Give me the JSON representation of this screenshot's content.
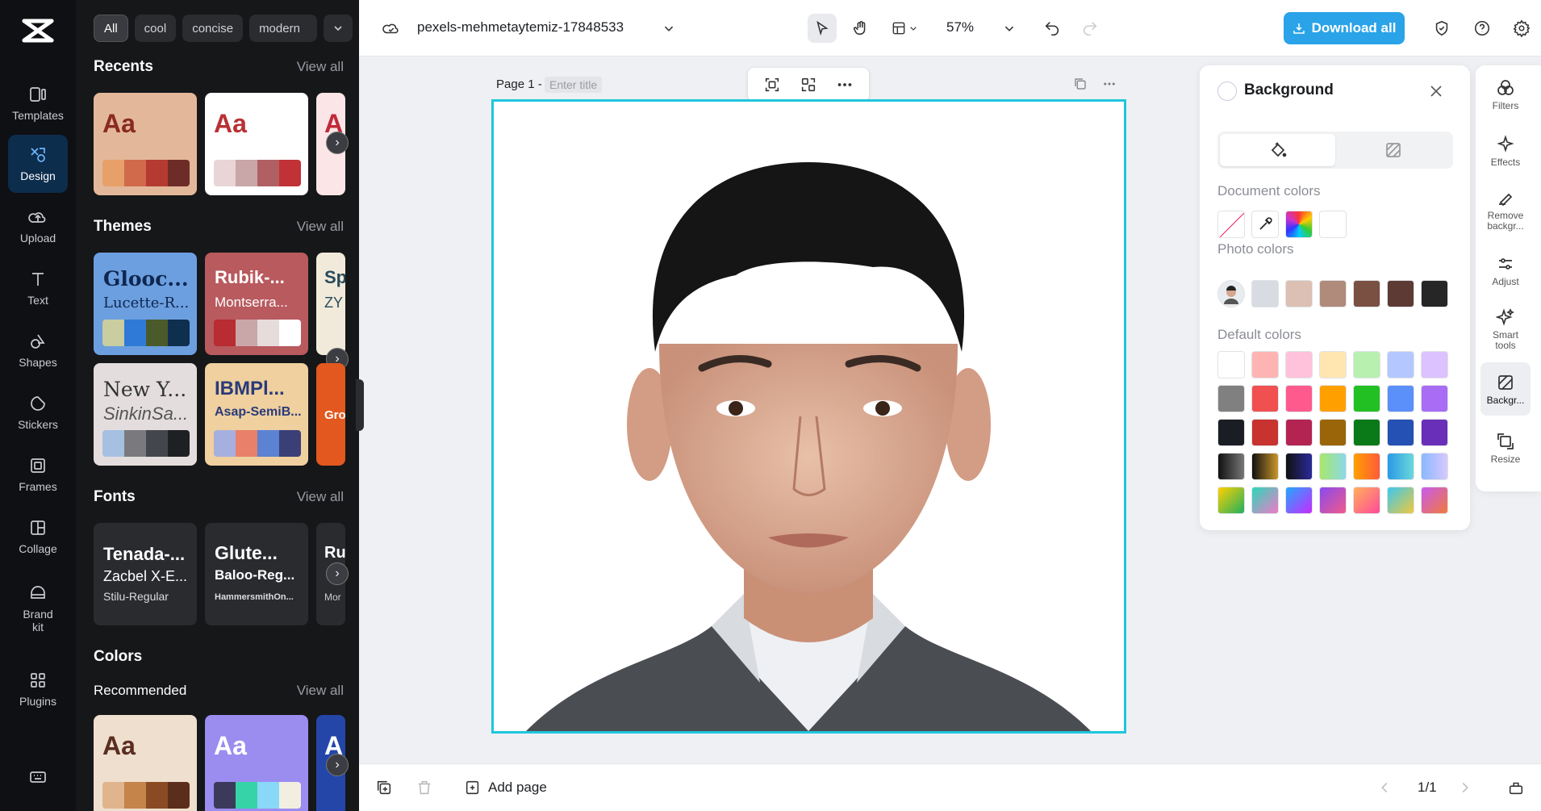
{
  "nav": {
    "items": [
      {
        "label": "Templates",
        "icon": "templates-icon"
      },
      {
        "label": "Design",
        "icon": "design-icon"
      },
      {
        "label": "Upload",
        "icon": "upload-icon"
      },
      {
        "label": "Text",
        "icon": "text-icon"
      },
      {
        "label": "Shapes",
        "icon": "shapes-icon"
      },
      {
        "label": "Stickers",
        "icon": "stickers-icon"
      },
      {
        "label": "Frames",
        "icon": "frames-icon"
      },
      {
        "label": "Collage",
        "icon": "collage-icon"
      },
      {
        "label": "Brand kit",
        "icon": "brand-kit-icon"
      },
      {
        "label": "Plugins",
        "icon": "plugins-icon"
      }
    ]
  },
  "panel": {
    "chips": [
      "All",
      "cool",
      "concise",
      "modern"
    ],
    "recents": {
      "title": "Recents",
      "view_all": "View all"
    },
    "themes": {
      "title": "Themes",
      "view_all": "View all",
      "row1": [
        {
          "t1": "Glooc...",
          "t2": "Lucette-R..."
        },
        {
          "t1": "Rubik-...",
          "t2": "Montserra..."
        },
        {
          "t1": "Sp",
          "t2": "ZY"
        }
      ],
      "row2": [
        {
          "t1": "New Y...",
          "t2": "SinkinSa..."
        },
        {
          "t1": "IBMPl...",
          "t2": "Asap-SemiB..."
        },
        {
          "t1": "",
          "t2": "Gro"
        }
      ]
    },
    "fonts": {
      "title": "Fonts",
      "view_all": "View all",
      "cards": [
        {
          "t1": "Tenada-...",
          "t2": "Zacbel X-E...",
          "t3": "Stilu-Regular"
        },
        {
          "t1": "Glute...",
          "t2": "Baloo-Reg...",
          "t3": "HammersmithOn..."
        },
        {
          "t1": "Ru",
          "t2": "",
          "t3": "Mor"
        }
      ]
    },
    "colors": {
      "title": "Colors",
      "recommended": "Recommended",
      "view_all": "View all"
    },
    "aa": "Aa",
    "palette_recent1": [
      "#e8a06a",
      "#d06a4a",
      "#b43a32",
      "#6e2c28"
    ],
    "palette_recent2": [
      "#e9d5d6",
      "#c9a6a7",
      "#b06063",
      "#c03236"
    ]
  },
  "topbar": {
    "filename": "pexels-mehmetaytemiz-17848533",
    "zoom": "57%",
    "download": "Download all"
  },
  "canvas": {
    "page_label": "Page 1 -",
    "title_placeholder": "Enter title"
  },
  "bottombar": {
    "add_page": "Add page",
    "pager": "1/1"
  },
  "bgpanel": {
    "title": "Background",
    "document_colors": "Document colors",
    "photo_colors": "Photo colors",
    "default_colors": "Default colors",
    "photo_swatches": [
      "#d8dbe2",
      "#dcc0b3",
      "#b08a7a",
      "#7a5042",
      "#5e3a34",
      "#262626"
    ],
    "default_rows": [
      [
        "#ffffff",
        "#ffb4b4",
        "#ffc2da",
        "#ffe6b0",
        "#b8f0b0",
        "#b4c8ff",
        "#dcc2ff"
      ],
      [
        "#808080",
        "#f05050",
        "#ff5a8e",
        "#ffa000",
        "#22c022",
        "#5b8ff9",
        "#a86cf5"
      ],
      [
        "#1a1d24",
        "#c8322f",
        "#b42452",
        "#9a6508",
        "#0a7a18",
        "#2451b3",
        "#6a2fb8"
      ]
    ]
  },
  "rail": {
    "items": [
      {
        "label": "Filters"
      },
      {
        "label": "Effects"
      },
      {
        "label": "Remove backgr..."
      },
      {
        "label": "Adjust"
      },
      {
        "label": "Smart tools"
      },
      {
        "label": "Backgr..."
      },
      {
        "label": "Resize"
      }
    ]
  }
}
